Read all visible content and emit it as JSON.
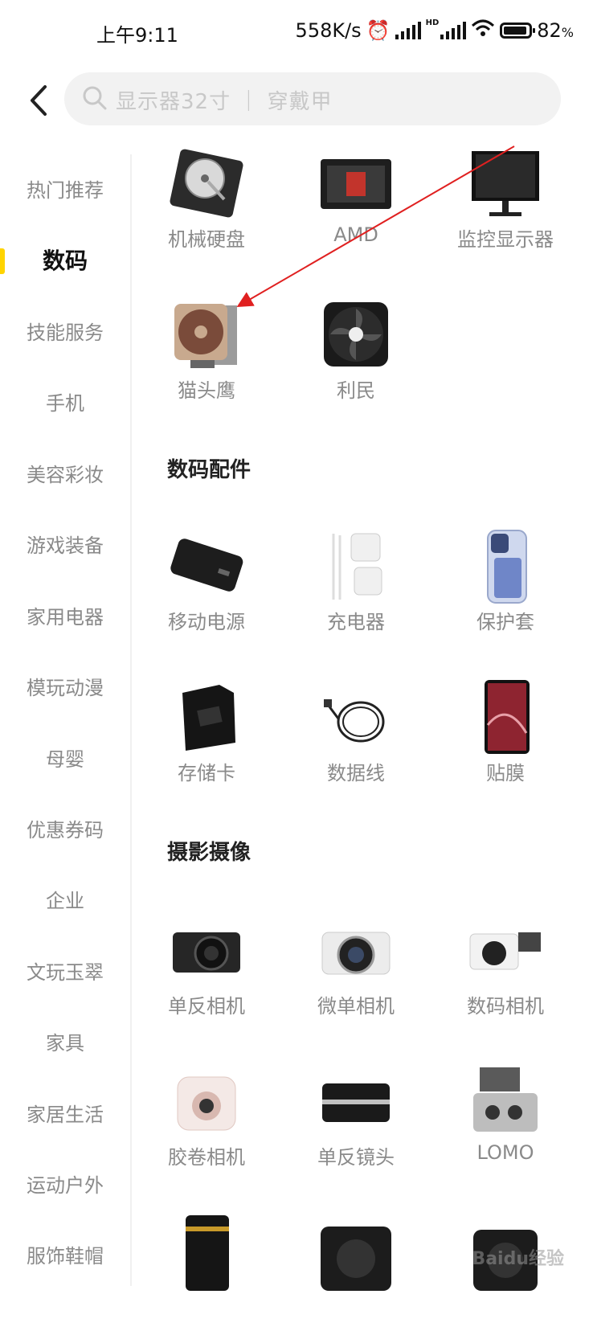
{
  "status": {
    "time": "上午9:11",
    "speed": "558K/s",
    "hd": "HD",
    "battery_pct": "82",
    "battery_unit": "%"
  },
  "search": {
    "placeholder": "显示器32寸 ｜ 穿戴甲",
    "icon": "search-icon"
  },
  "colors": {
    "accent": "#ffd400",
    "active_text": "#111111",
    "inactive_text": "#8a8a8a"
  },
  "sidebar": {
    "active_index": 1,
    "items": [
      "热门推荐",
      "数码",
      "技能服务",
      "手机",
      "美容彩妆",
      "游戏装备",
      "家用电器",
      "模玩动漫",
      "母婴",
      "优惠券码",
      "企业",
      "文玩玉翠",
      "家具",
      "家居生活",
      "运动户外",
      "服饰鞋帽"
    ]
  },
  "sections": [
    {
      "title": "",
      "items": [
        "机械硬盘",
        "AMD",
        "监控显示器",
        "猫头鹰",
        "利民"
      ]
    },
    {
      "title": "数码配件",
      "items": [
        "移动电源",
        "充电器",
        "保护套",
        "存储卡",
        "数据线",
        "贴膜"
      ]
    },
    {
      "title": "摄影摄像",
      "items": [
        "单反相机",
        "微单相机",
        "数码相机",
        "胶卷相机",
        "单反镜头",
        "LOMO"
      ]
    }
  ],
  "watermark": "Baidu经验"
}
